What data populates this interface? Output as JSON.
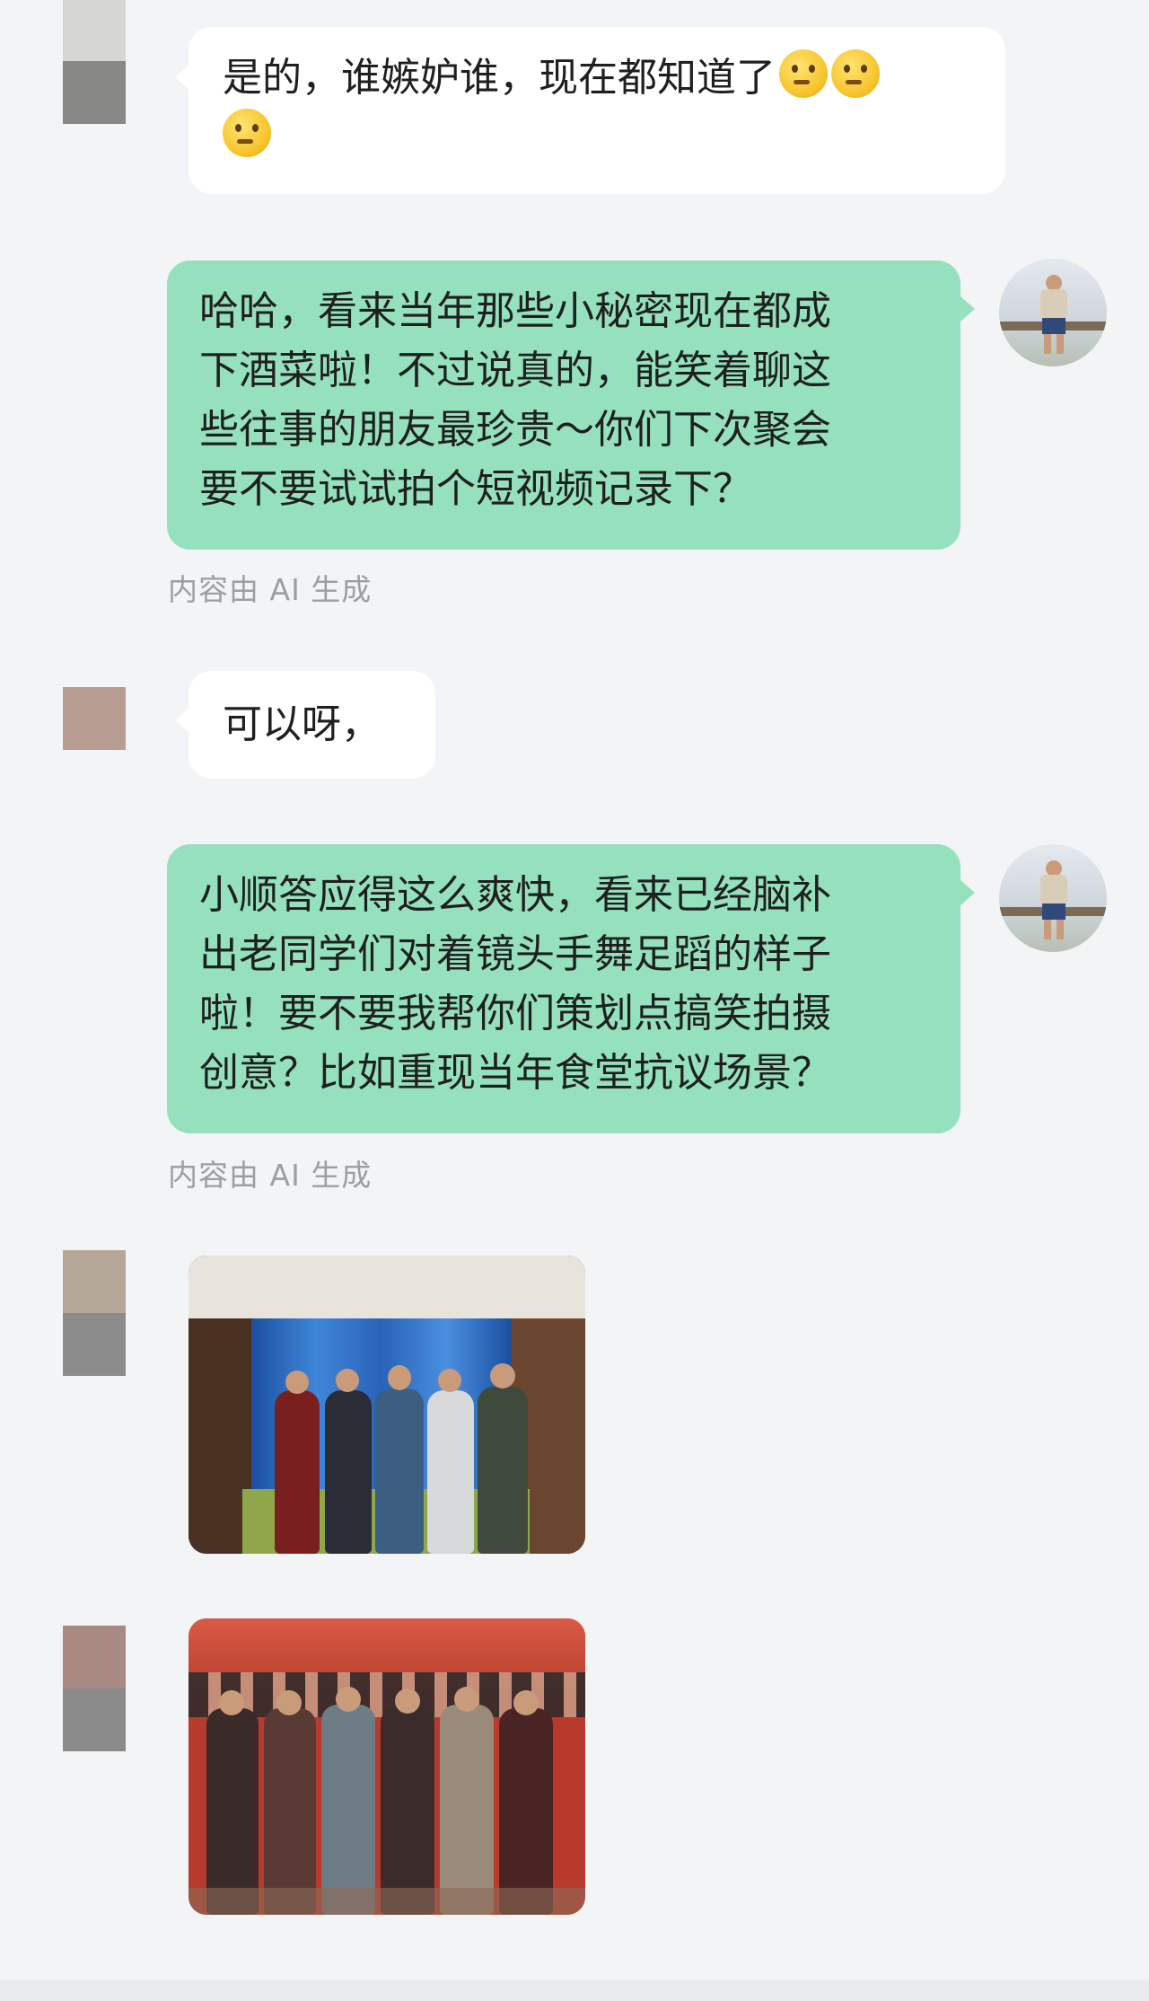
{
  "messages": [
    {
      "side": "in",
      "text": "是的，谁嫉妒谁，现在都知道了",
      "emoji_count": 3,
      "emoji_name": "thinking-face"
    },
    {
      "side": "out",
      "lines": [
        "哈哈，看来当年那些小秘密现在都成",
        "下酒菜啦！不过说真的，能笑着聊这",
        "些往事的朋友最珍贵～你们下次聚会",
        "要不要试试拍个短视频记录下？"
      ],
      "note": "内容由 AI 生成"
    },
    {
      "side": "in",
      "text": "可以呀，"
    },
    {
      "side": "out",
      "lines": [
        "小顺答应得这么爽快，看来已经脑补",
        "出老同学们对着镜头手舞足蹈的样子",
        "啦！要不要我帮你们策划点搞笑拍摄",
        "创意？比如重现当年食堂抗议场景？"
      ],
      "note": "内容由 AI 生成"
    },
    {
      "side": "in",
      "type": "image",
      "description_icon": "group-photo-modern"
    },
    {
      "side": "in",
      "type": "image",
      "description_icon": "group-photo-vintage"
    }
  ],
  "colors": {
    "background": "#f3f4f6",
    "incoming_bubble": "#ffffff",
    "outgoing_bubble": "#95e1bd",
    "note_text": "#9c9ea3"
  }
}
